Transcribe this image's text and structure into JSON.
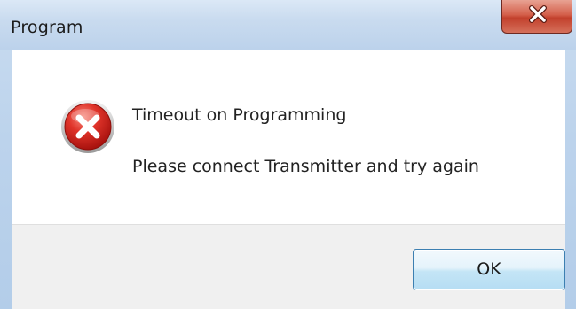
{
  "window": {
    "title": "Program",
    "close_icon": "close-x-icon"
  },
  "message": {
    "icon": "error-icon",
    "line1": "Timeout on Programming",
    "line2": "Please connect Transmitter and try again"
  },
  "buttons": {
    "ok_label": "OK"
  },
  "colors": {
    "error_red": "#d72a2a",
    "close_red": "#c2402c",
    "button_border": "#3c7fb1"
  }
}
